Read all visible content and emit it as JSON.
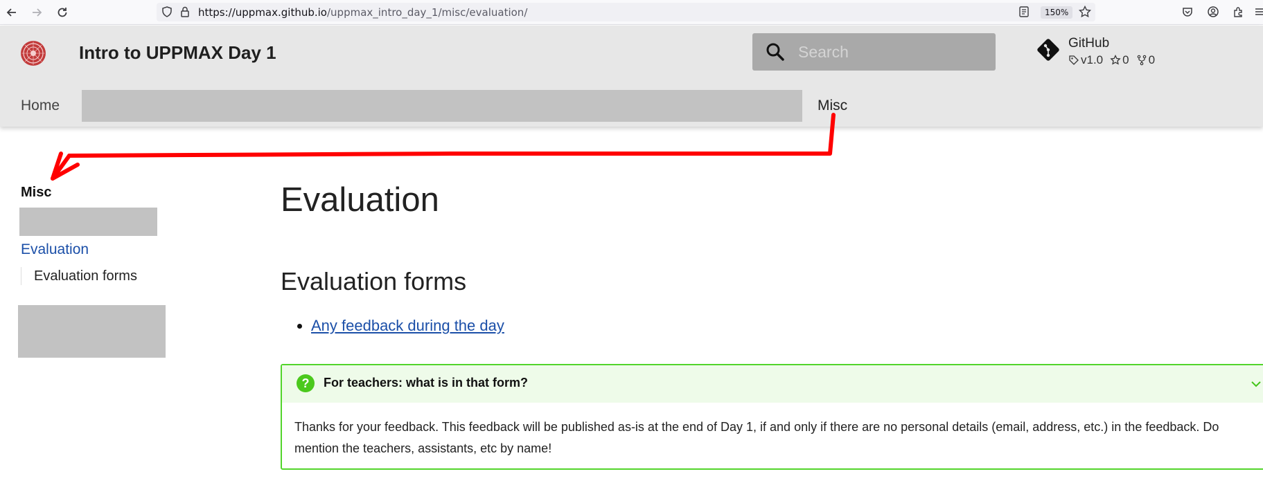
{
  "browser": {
    "url_host": "https://uppmax.github.io",
    "url_path": "/uppmax_intro_day_1/misc/evaluation/",
    "zoom": "150%"
  },
  "header": {
    "site_title": "Intro to UPPMAX Day 1",
    "search_placeholder": "Search",
    "repo": {
      "name": "GitHub",
      "version": "v1.0",
      "stars": "0",
      "forks": "0"
    },
    "tabs": {
      "home": "Home",
      "misc": "Misc"
    }
  },
  "sidebar": {
    "title": "Misc",
    "active_item": "Evaluation",
    "sub_item": "Evaluation forms"
  },
  "main": {
    "title": "Evaluation",
    "section_title": "Evaluation forms",
    "links": [
      "Any feedback during the day"
    ],
    "admonition": {
      "title": "For teachers: what is in that form?",
      "body": "Thanks for your feedback. This feedback will be published as-is at the end of Day 1, if and only if there are no personal details (email, address, etc.) in the feedback. Do mention the teachers, assistants, etc by name!"
    }
  },
  "colors": {
    "header_bg": "#e7e7e7",
    "link": "#1b4fa8",
    "admonition_border": "#52d52b",
    "admonition_bg": "#eefbe9",
    "annotation_arrow": "#ff0000"
  }
}
